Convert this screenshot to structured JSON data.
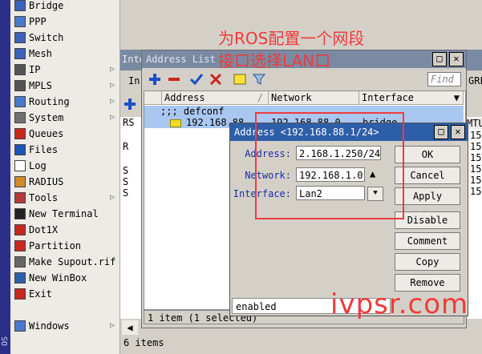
{
  "sidebar": {
    "brand_vertical": "OS",
    "items": [
      {
        "label": "Bridge",
        "icon": "bridge-icon",
        "arrow": false
      },
      {
        "label": "PPP",
        "icon": "ppp-icon",
        "arrow": false
      },
      {
        "label": "Switch",
        "icon": "switch-icon",
        "arrow": false
      },
      {
        "label": "Mesh",
        "icon": "mesh-icon",
        "arrow": false
      },
      {
        "label": "IP",
        "icon": "ip-icon",
        "arrow": true
      },
      {
        "label": "MPLS",
        "icon": "mpls-icon",
        "arrow": true
      },
      {
        "label": "Routing",
        "icon": "routing-icon",
        "arrow": true
      },
      {
        "label": "System",
        "icon": "gear-icon",
        "arrow": true
      },
      {
        "label": "Queues",
        "icon": "queues-icon",
        "arrow": false
      },
      {
        "label": "Files",
        "icon": "folder-icon",
        "arrow": false
      },
      {
        "label": "Log",
        "icon": "log-icon",
        "arrow": false
      },
      {
        "label": "RADIUS",
        "icon": "users-icon",
        "arrow": false
      },
      {
        "label": "Tools",
        "icon": "tools-icon",
        "arrow": true
      },
      {
        "label": "New Terminal",
        "icon": "terminal-icon",
        "arrow": false
      },
      {
        "label": "Dot1X",
        "icon": "dot1x-icon",
        "arrow": false
      },
      {
        "label": "Partition",
        "icon": "partition-icon",
        "arrow": false
      },
      {
        "label": "Make Supout.rif",
        "icon": "supout-icon",
        "arrow": false
      },
      {
        "label": "New WinBox",
        "icon": "winbox-icon",
        "arrow": false
      },
      {
        "label": "Exit",
        "icon": "exit-icon",
        "arrow": false
      },
      {
        "label": "Windows",
        "icon": "windows-icon",
        "arrow": true
      }
    ]
  },
  "bg_window": {
    "title": "Inte",
    "col_frag": "In",
    "right_col": "GRE",
    "mtu_col": "MTU",
    "left_flags": [
      "RS",
      "R",
      "S",
      "S",
      "S"
    ],
    "right_vals": [
      "15",
      "15",
      "15",
      "15",
      "15",
      "15"
    ],
    "status": "6 items"
  },
  "address_list": {
    "title": "Address List",
    "find_placeholder": "Find",
    "columns": [
      "Address",
      "Network",
      "Interface"
    ],
    "group_label": ";;; defconf",
    "row": {
      "address": "192.168.88",
      "network": "192.168.88.0",
      "interface": "bridge"
    },
    "status": "1 item (1 selected)"
  },
  "dialog": {
    "title": "Address <192.168.88.1/24>",
    "fields": {
      "address_label": "Address:",
      "address_value": "2.168.1.250/24",
      "network_label": "Network:",
      "network_value": "192.168.1.0",
      "interface_label": "Interface:",
      "interface_value": "Lan2"
    },
    "buttons": [
      "OK",
      "Cancel",
      "Apply",
      "Disable",
      "Comment",
      "Copy",
      "Remove"
    ],
    "status": "enabled"
  },
  "annotation": {
    "line1": "为ROS配置一个网段",
    "line2": "接口选择LAN口"
  },
  "watermark": "ivpsr.com",
  "colors": {
    "annotation_red": "#ef3b3b",
    "dialog_title": "#2d5ea8",
    "selected_row": "#a9c7f0"
  }
}
